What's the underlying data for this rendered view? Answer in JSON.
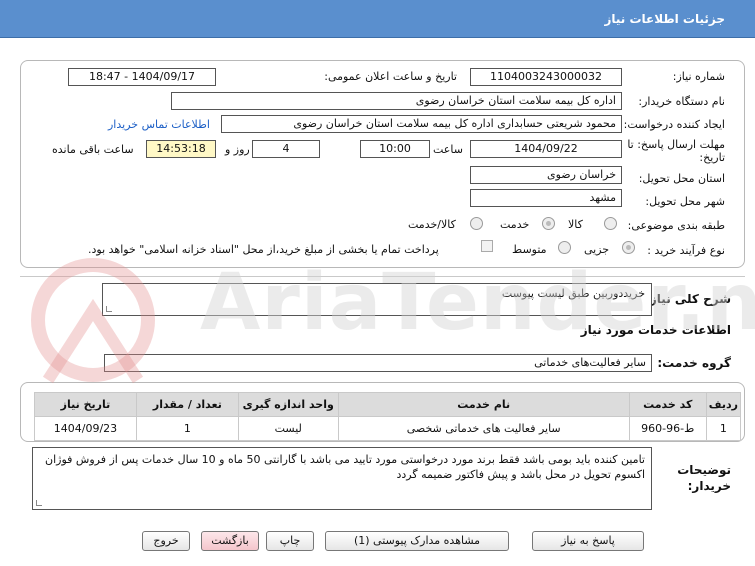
{
  "header": {
    "title": "جزئیات اطلاعات نیاز"
  },
  "form": {
    "need_number_label": "شماره نیاز:",
    "need_number": "1104003243000032",
    "announce_label": "تاریخ و ساعت اعلان عمومی:",
    "announce_value": "1404/09/17 - 18:47",
    "buyer_org_label": "نام دستگاه خریدار:",
    "buyer_org": "اداره کل بیمه سلامت استان خراسان رضوی",
    "creator_label": "ایجاد کننده درخواست:",
    "creator": "محمود شریعتی حسابداری اداره کل بیمه سلامت استان خراسان رضوی",
    "contact_link": "اطلاعات تماس خریدار",
    "deadline_label_1": "مهلت ارسال پاسخ: تا",
    "deadline_label_2": "تاریخ:",
    "deadline_date": "1404/09/22",
    "time_label": "ساعت",
    "deadline_time": "10:00",
    "days": "4",
    "days_label": "روز و",
    "remaining_time": "14:53:18",
    "remaining_label": "ساعت باقی مانده",
    "province_label": "استان محل تحویل:",
    "province": "خراسان رضوی",
    "city_label": "شهر محل تحویل:",
    "city": "مشهد",
    "category_label": "طبقه بندی موضوعی:",
    "category_options": [
      "کالا",
      "خدمت",
      "کالا/خدمت"
    ],
    "category_selected": "خدمت",
    "process_label": "نوع فرآیند خرید :",
    "process_options": [
      "جزیی",
      "متوسط"
    ],
    "process_selected": "جزیی",
    "payment_note": "پرداخت تمام یا بخشی از مبلغ خرید،از محل \"اسناد خزانه اسلامی\" خواهد بود."
  },
  "summary": {
    "label": "شرح کلی نیاز:",
    "value": "خریددوربین  طبق لیست پیوست"
  },
  "services": {
    "section_title": "اطلاعات خدمات مورد نیاز",
    "group_label": "گروه خدمت:",
    "group_value": "سایر فعالیت‌های خدماتی",
    "columns": [
      "ردیف",
      "کد خدمت",
      "نام خدمت",
      "واحد اندازه گیری",
      "تعداد / مقدار",
      "تاریخ نیاز"
    ],
    "rows": [
      [
        "1",
        "ط-96-960",
        "سایر فعالیت های خدماتی شخصی",
        "لیست",
        "1",
        "1404/09/23"
      ]
    ]
  },
  "buyer_notes": {
    "label_1": "توضیحات",
    "label_2": "خریدار:",
    "text": "تامین کننده باید بومی باشد فقط برند مورد درخواستی مورد تایید می باشد  با گارانتی 50 ماه و 10 سال خدمات پس از فروش فوژان اکسوم  تحویل در محل باشد و پیش فاکتور ضمیمه گردد"
  },
  "buttons": {
    "reply": "پاسخ به نیاز",
    "attachments": "مشاهده مدارک پیوستی (1)",
    "print": "چاپ",
    "back": "بازگشت",
    "exit": "خروج"
  },
  "watermark": {
    "text": "AriaTender.net"
  },
  "colors": {
    "title_bar": "#5a8fce",
    "link": "#1c5fc6",
    "highlight_box": "#fff8c6",
    "back_button": "#f9d3d8"
  }
}
